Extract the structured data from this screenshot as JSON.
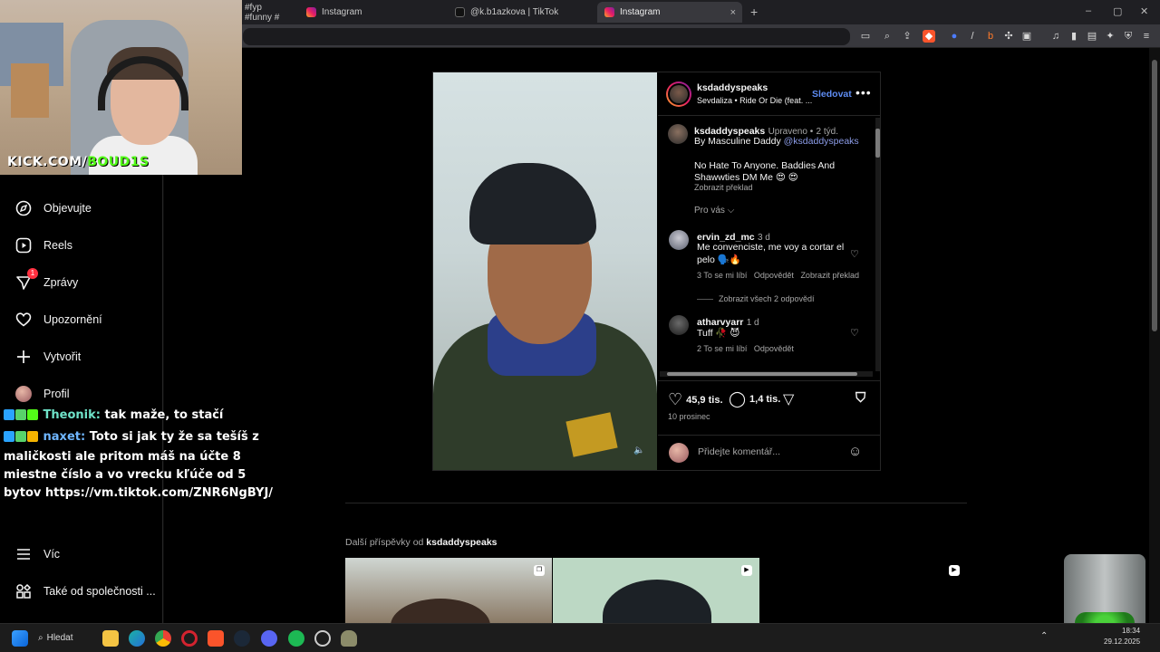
{
  "browser": {
    "tabs": [
      {
        "label": "#fyp #funny #",
        "favicon": "none"
      },
      {
        "label": "Instagram",
        "favicon": "instagram-icon"
      },
      {
        "label": "@k.b1azkova | TikTok",
        "favicon": "tiktok-icon"
      },
      {
        "label": "Instagram",
        "favicon": "instagram-icon",
        "active": true
      }
    ],
    "new_tab": "+",
    "close": "×",
    "window_controls": [
      "–",
      "▢",
      "✕"
    ]
  },
  "webcam": {
    "overlay_prefix": "KICK.COM/",
    "overlay_handle": "BOUD1S"
  },
  "nav": {
    "items": [
      {
        "label": "Objevujte",
        "icon": "compass-icon"
      },
      {
        "label": "Reels",
        "icon": "reels-icon"
      },
      {
        "label": "Zprávy",
        "icon": "messages-icon",
        "badge": "1"
      },
      {
        "label": "Upozornění",
        "icon": "heart-icon"
      },
      {
        "label": "Vytvořit",
        "icon": "plus-icon"
      },
      {
        "label": "Profil",
        "icon": "avatar"
      }
    ],
    "bottom_items": [
      {
        "label": "Víc",
        "icon": "menu-icon"
      },
      {
        "label": "Také od společnosti ...",
        "icon": "meta-apps-icon"
      }
    ]
  },
  "chat": [
    {
      "user": "Theonik:",
      "message": "tak maže, to stačí"
    },
    {
      "user": "naxet:",
      "message": "Toto si jak ty že sa tešíš z maličkosti ale pritom máš na účte 8 miestne číslo a vo vrecku kľúče od 5 bytov https://vm.tiktok.com/ZNR6NgBYJ/"
    }
  ],
  "post": {
    "author": "ksdaddyspeaks",
    "audio": "Sevdaliza • Ride Or Die (feat. ...",
    "follow_label": "Sledovat",
    "more": "•••",
    "caption": {
      "user": "ksdaddyspeaks",
      "edited": "Upraveno •",
      "age": "2 týd.",
      "line1_prefix": "By Masculine Daddy ",
      "line1_mention": "@ksdaddyspeaks",
      "line2": "No Hate To Anyone. Baddies And",
      "line3": "Shawwties DM Me 😍 😍",
      "translate": "Zobrazit překlad"
    },
    "for_you": "Pro vás",
    "comments": [
      {
        "user": "ervin_zd_mc",
        "age": "3 d",
        "text1": "Me convenciste, me voy a cortar el",
        "text2": "pelo 🗣️🔥",
        "likes": "3 To se mi líbí",
        "reply": "Odpovědět",
        "translate": "Zobrazit překlad",
        "view_replies": "Zobrazit všech 2 odpovědí"
      },
      {
        "user": "atharvyarr",
        "age": "1 d",
        "text1": "Tuff 🥀 😈",
        "likes": "2 To se mi líbí",
        "reply": "Odpovědět"
      }
    ],
    "likes": "45,9 tis.",
    "comment_count": "1,4 tis.",
    "date": "10 prosinec",
    "comment_placeholder": "Přidejte komentář...",
    "more_from_label": "Další příspěvky od",
    "more_from_user": "ksdaddyspeaks"
  },
  "taskbar": {
    "search_label": "Hledat",
    "time": "18:34",
    "date": "29.12.2025"
  },
  "colors": {
    "accent_blue": "#5e8cf3",
    "link": "#8c9ce8",
    "badge": "#ff3040",
    "kick_green": "#53fc18"
  }
}
